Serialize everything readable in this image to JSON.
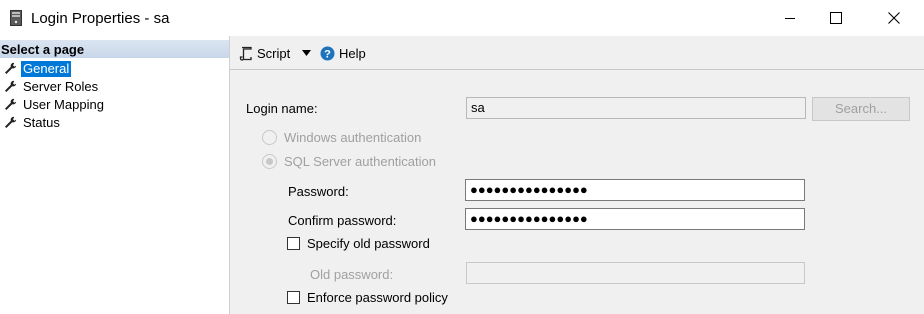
{
  "window": {
    "title": "Login Properties - sa",
    "icon": "server-icon",
    "controls": {
      "minimize": "minimize-icon",
      "maximize": "maximize-icon",
      "close": "close-icon"
    }
  },
  "sidebar": {
    "header": "Select a page",
    "items": [
      {
        "label": "General",
        "selected": true
      },
      {
        "label": "Server Roles",
        "selected": false
      },
      {
        "label": "User Mapping",
        "selected": false
      },
      {
        "label": "Status",
        "selected": false
      }
    ]
  },
  "toolbar": {
    "script_label": "Script",
    "help_label": "Help"
  },
  "form": {
    "login_name_label": "Login name:",
    "login_name_value": "sa",
    "search_label": "Search...",
    "windows_auth_label": "Windows authentication",
    "sql_auth_label": "SQL Server authentication",
    "sql_auth_selected": true,
    "password_label": "Password:",
    "password_value": "●●●●●●●●●●●●●●●",
    "confirm_password_label": "Confirm password:",
    "confirm_password_value": "●●●●●●●●●●●●●●●",
    "specify_old_password_label": "Specify old password",
    "specify_old_password_checked": false,
    "old_password_label": "Old password:",
    "old_password_value": "",
    "enforce_policy_label": "Enforce password policy",
    "enforce_policy_checked": false
  },
  "colors": {
    "selection": "#0078d7",
    "pane_background": "#f0f0f0",
    "disabled_text": "#a0a0a0",
    "help_icon": "#1e73be"
  }
}
